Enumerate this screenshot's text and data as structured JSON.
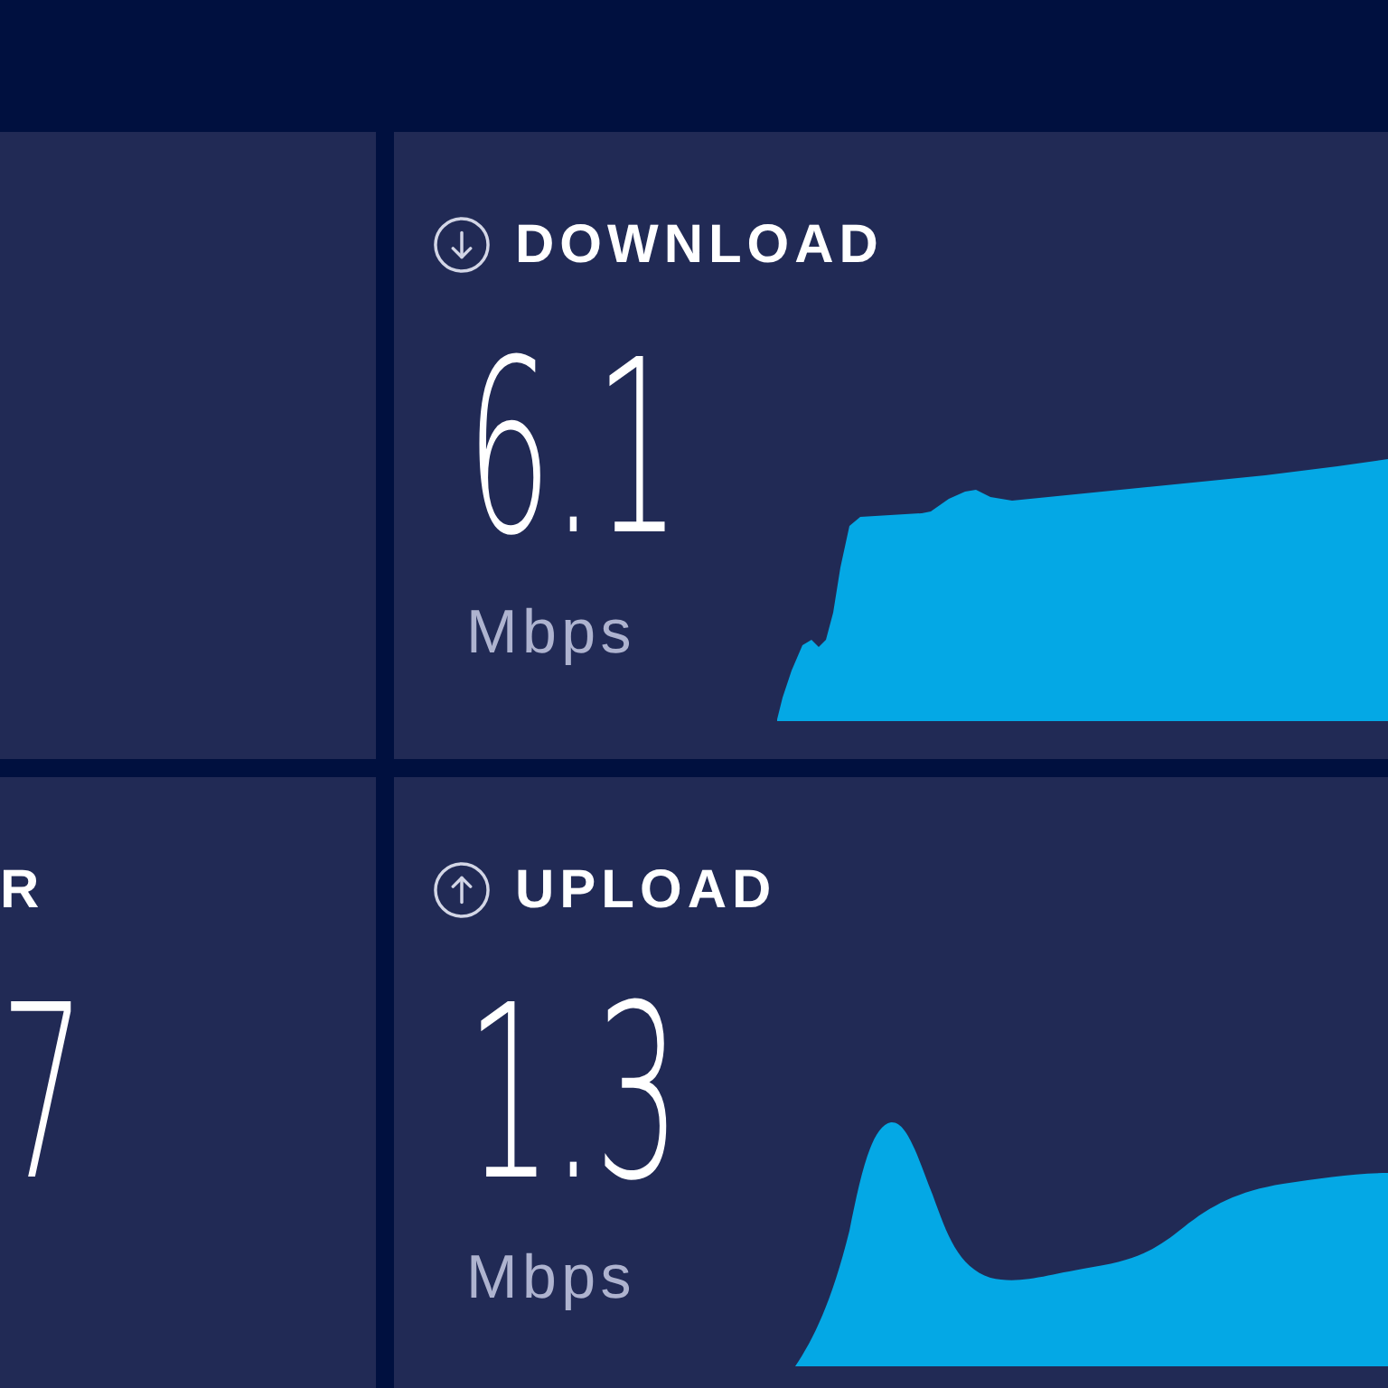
{
  "side_panel": {
    "label": "R",
    "value": "7"
  },
  "results": [
    {
      "kind": "download",
      "label": "DOWNLOAD",
      "value": "6.1",
      "unit": "Mbps"
    },
    {
      "kind": "upload",
      "label": "UPLOAD",
      "value": "1.3",
      "unit": "Mbps"
    }
  ]
}
